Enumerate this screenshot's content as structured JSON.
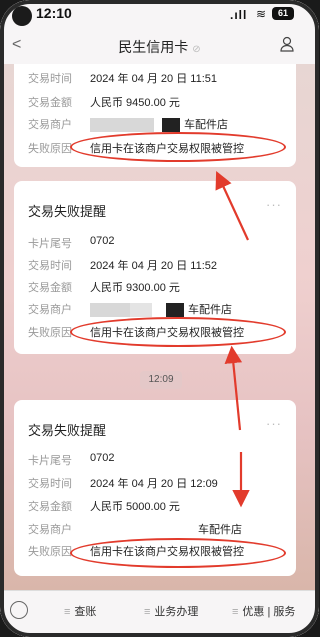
{
  "status": {
    "time": "12:10",
    "battery": "61"
  },
  "nav": {
    "title": "民生信用卡",
    "back": "<"
  },
  "labels": {
    "card_tail": "卡片尾号",
    "time": "交易时间",
    "amount": "交易金额",
    "merchant": "交易商户",
    "reason": "失败原因"
  },
  "card1": {
    "time": "2024 年 04 月 20 日 11:51",
    "amount": "人民币 9450.00 元",
    "merchant": "车配件店",
    "reason": "信用卡在该商户交易权限被管控"
  },
  "card2": {
    "title": "交易失败提醒",
    "more": "···",
    "card_tail": "0702",
    "time": "2024 年 04 月 20 日 11:52",
    "amount": "人民币 9300.00 元",
    "merchant": "车配件店",
    "reason": "信用卡在该商户交易权限被管控"
  },
  "timestamp": "12:09",
  "card3": {
    "title": "交易失败提醒",
    "more": "···",
    "card_tail": "0702",
    "time": "2024 年 04 月 20 日 12:09",
    "amount": "人民币 5000.00 元",
    "merchant": "车配件店",
    "reason": "信用卡在该商户交易权限被管控"
  },
  "tabbar": {
    "items": [
      "查账",
      "业务办理",
      "优惠 | 服务"
    ]
  },
  "colors": {
    "annotation": "#e23b2c",
    "card": "#ffffff"
  }
}
